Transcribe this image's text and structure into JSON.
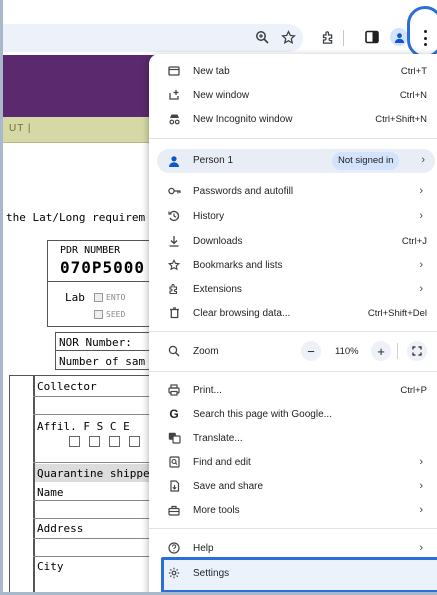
{
  "toolbar": {
    "zoom_icon": "zoom-in-icon",
    "star_icon": "bookmark-star-icon",
    "extensions_icon": "puzzle-icon",
    "sidepanel_icon": "side-panel-icon",
    "profile_icon": "person-icon",
    "menu_icon": "kebab-menu-icon"
  },
  "page": {
    "nav_fragment": "UT  |",
    "latlong_text": "the Lat/Long requirem",
    "pdr_label": "PDR NUMBER",
    "pdr_number": "070P5000",
    "lab_label": "Lab",
    "ento_label": "ENTO",
    "seed_label": "SEED",
    "nor_label": "NOR Number:",
    "num_samples_label": "Number of sam",
    "collector_label": "Collector",
    "affil_label": "Affil. F  S  C  E",
    "quarantine_label": "Quarantine shipper",
    "name_label": "Name",
    "address_label": "Address",
    "city_label": "City"
  },
  "menu": {
    "new_tab": {
      "label": "New tab",
      "shortcut": "Ctrl+T"
    },
    "new_window": {
      "label": "New window",
      "shortcut": "Ctrl+N"
    },
    "new_incognito": {
      "label": "New Incognito window",
      "shortcut": "Ctrl+Shift+N"
    },
    "person": {
      "label": "Person 1",
      "status": "Not signed in"
    },
    "passwords": {
      "label": "Passwords and autofill"
    },
    "history": {
      "label": "History"
    },
    "downloads": {
      "label": "Downloads",
      "shortcut": "Ctrl+J"
    },
    "bookmarks": {
      "label": "Bookmarks and lists"
    },
    "extensions": {
      "label": "Extensions"
    },
    "clear_data": {
      "label": "Clear browsing data...",
      "shortcut": "Ctrl+Shift+Del"
    },
    "zoom": {
      "label": "Zoom",
      "minus": "−",
      "value": "110%",
      "plus": "+"
    },
    "print": {
      "label": "Print...",
      "shortcut": "Ctrl+P"
    },
    "search_google": {
      "label": "Search this page with Google..."
    },
    "translate": {
      "label": "Translate..."
    },
    "find_edit": {
      "label": "Find and edit"
    },
    "save_share": {
      "label": "Save and share"
    },
    "more_tools": {
      "label": "More tools"
    },
    "help": {
      "label": "Help"
    },
    "settings": {
      "label": "Settings"
    }
  },
  "colors": {
    "highlight": "#2b6fd6",
    "banner": "#5b2a6e",
    "navbar": "#d6d9a6",
    "person_row": "#e9eef6",
    "badge": "#d3e3fd"
  }
}
